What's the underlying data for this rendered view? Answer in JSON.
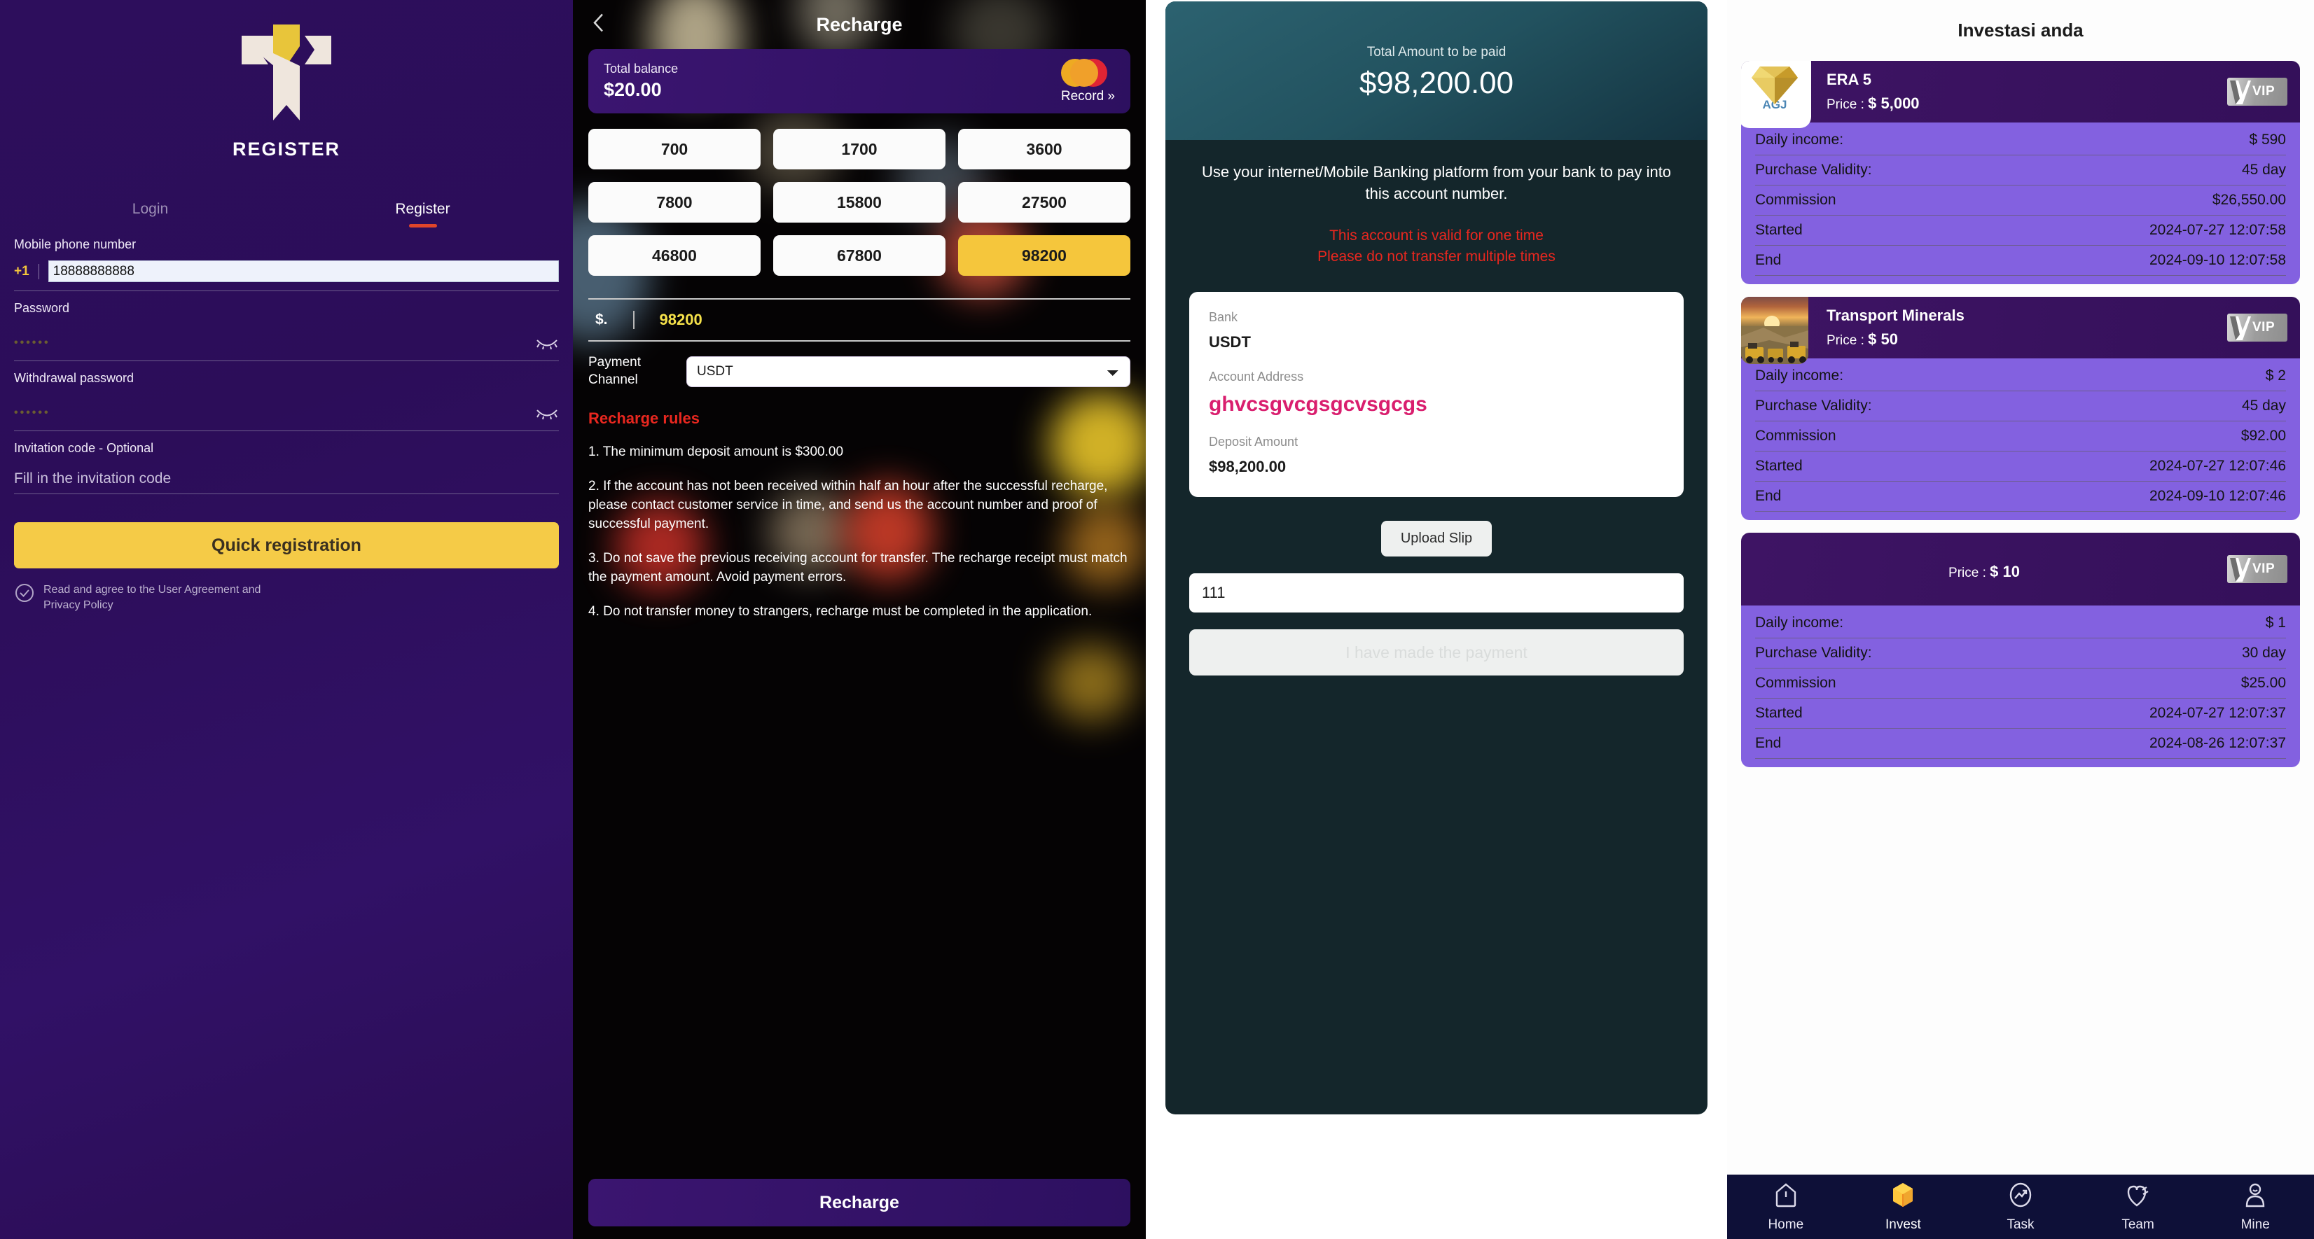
{
  "register": {
    "logo_icon": "brand-logo-icon",
    "title": "REGISTER",
    "tabs": [
      {
        "label": "Login",
        "active": false
      },
      {
        "label": "Register",
        "active": true
      }
    ],
    "phone": {
      "label": "Mobile phone number",
      "country_code": "+1",
      "value": "18888888888"
    },
    "password": {
      "label": "Password",
      "value": "••••••",
      "toggle_icon": "eye-closed-icon"
    },
    "withdrawal_password": {
      "label": "Withdrawal password",
      "value": "••••••",
      "toggle_icon": "eye-closed-icon"
    },
    "invitation": {
      "label": "Invitation code - Optional",
      "placeholder": "Fill in the invitation code",
      "value": ""
    },
    "submit_label": "Quick registration",
    "agreement": {
      "checkbox_icon": "check-circle-icon",
      "text": "Read and agree to the User Agreement and Privacy Policy",
      "checked": true
    },
    "colors": {
      "accent": "#f5cb47",
      "underline": "#e0452a",
      "bg": "#2d0e5c"
    }
  },
  "recharge": {
    "back_icon": "chevron-left-icon",
    "title": "Recharge",
    "balance": {
      "label": "Total balance",
      "amount": "$20.00",
      "record_label": "Record »",
      "card_icon": "mastercard-icon"
    },
    "amount_options": [
      {
        "label": "700",
        "selected": false
      },
      {
        "label": "1700",
        "selected": false
      },
      {
        "label": "3600",
        "selected": false
      },
      {
        "label": "7800",
        "selected": false
      },
      {
        "label": "15800",
        "selected": false
      },
      {
        "label": "27500",
        "selected": false
      },
      {
        "label": "46800",
        "selected": false
      },
      {
        "label": "67800",
        "selected": false
      },
      {
        "label": "98200",
        "selected": true
      }
    ],
    "amount_field": {
      "currency": "$.",
      "value": "98200"
    },
    "payment_channel": {
      "label": "Payment Channel",
      "selected": "USDT",
      "options": [
        "USDT"
      ],
      "chevron_icon": "chevron-down-icon"
    },
    "rules_title": "Recharge rules",
    "rules": [
      "1. The minimum deposit amount is $300.00",
      "2. If the account has not been received within half an hour after the successful recharge, please contact customer service in time, and send us the account number and proof of successful payment.",
      "3. Do not save the previous receiving account for transfer. The recharge receipt must match the payment amount. Avoid payment errors.",
      "4. Do not transfer money to strangers, recharge must be completed in the application."
    ],
    "submit_label": "Recharge",
    "colors": {
      "accent": "#f5c63c",
      "rules": "#e8271f",
      "card": "#3b1570"
    }
  },
  "payment": {
    "total_label": "Total Amount to be paid",
    "total_amount": "$98,200.00",
    "description": "Use your internet/Mobile Banking platform from your bank to pay into this account number.",
    "warning_line1": "This account is valid for one time",
    "warning_line2": "Please do not transfer multiple times",
    "details": {
      "bank_label": "Bank",
      "bank_value": "USDT",
      "address_label": "Account Address",
      "address_value": "ghvcsgvcgsgcvsgcgs",
      "deposit_label": "Deposit Amount",
      "deposit_value": "$98,200.00"
    },
    "upload_label": "Upload Slip",
    "slip_value": "111",
    "slip_placeholder": "",
    "confirm_label": "I have made the payment",
    "confirm_disabled": true,
    "colors": {
      "header": "#2c6270",
      "body": "#14262b",
      "address": "#d91e6e",
      "warning": "#e8271f"
    }
  },
  "investments": {
    "title": "Investasi anda",
    "cards": [
      {
        "name": "ERA 5",
        "price_label": "Price :",
        "price": "$ 5,000",
        "badge": "VIP",
        "badge_icon": "vip-badge-icon",
        "thumb_icon": "diamond-icon",
        "thumb_label": "AGJ",
        "rows": [
          {
            "label": "Daily income:",
            "value": "$ 590"
          },
          {
            "label": "Purchase Validity:",
            "value": "45 day"
          },
          {
            "label": "Commission",
            "value": "$26,550.00"
          },
          {
            "label": "Started",
            "value": "2024-07-27 12:07:58"
          },
          {
            "label": "End",
            "value": "2024-09-10 12:07:58"
          }
        ]
      },
      {
        "name": "Transport Minerals",
        "price_label": "Price :",
        "price": "$ 50",
        "badge": "VIP",
        "badge_icon": "vip-badge-icon",
        "thumb_icon": "mining-photo-icon",
        "thumb_label": "",
        "rows": [
          {
            "label": "Daily income:",
            "value": "$ 2"
          },
          {
            "label": "Purchase Validity:",
            "value": "45 day"
          },
          {
            "label": "Commission",
            "value": "$92.00"
          },
          {
            "label": "Started",
            "value": "2024-07-27 12:07:46"
          },
          {
            "label": "End",
            "value": "2024-09-10 12:07:46"
          }
        ]
      },
      {
        "name": "",
        "price_label": "Price :",
        "price": "$ 10",
        "badge": "VIP",
        "badge_icon": "vip-badge-icon",
        "thumb_icon": "",
        "thumb_label": "",
        "rows": [
          {
            "label": "Daily income:",
            "value": "$ 1"
          },
          {
            "label": "Purchase Validity:",
            "value": "30 day"
          },
          {
            "label": "Commission",
            "value": "$25.00"
          },
          {
            "label": "Started",
            "value": "2024-07-27 12:07:37"
          },
          {
            "label": "End",
            "value": "2024-08-26 12:07:37"
          }
        ]
      }
    ],
    "tabbar": [
      {
        "label": "Home",
        "icon": "home-icon",
        "active": false
      },
      {
        "label": "Invest",
        "icon": "cube-icon",
        "active": true
      },
      {
        "label": "Task",
        "icon": "chart-icon",
        "active": false
      },
      {
        "label": "Team",
        "icon": "team-icon",
        "active": false
      },
      {
        "label": "Mine",
        "icon": "person-icon",
        "active": false
      }
    ],
    "colors": {
      "head": "#3e1464",
      "rows": "#8361e0",
      "tabbar": "#0e1038",
      "active": "#f5a623"
    }
  }
}
